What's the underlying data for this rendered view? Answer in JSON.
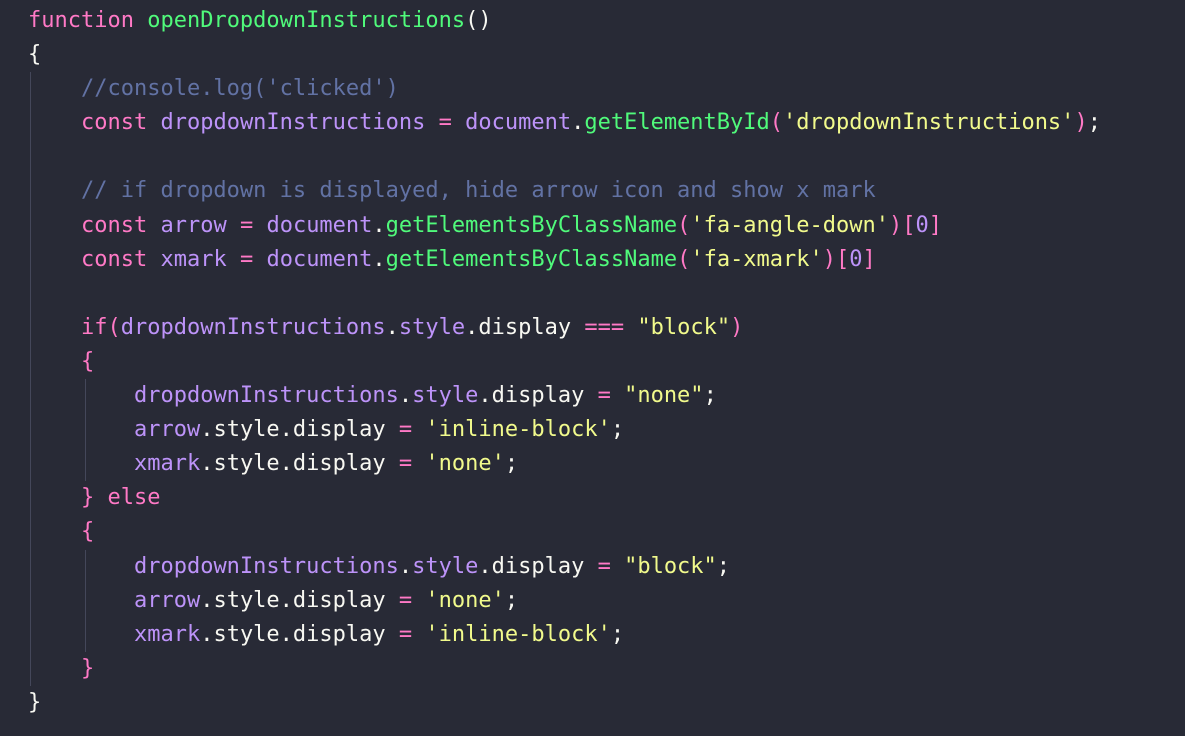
{
  "theme": {
    "background": "#282a36",
    "guide": "#44475a",
    "colors": {
      "kw": "#ff79c6",
      "fn": "#50fa7b",
      "str": "#f1fa8c",
      "var": "#bd93f9",
      "cmt": "#6272a4",
      "plain": "#f8f8f2",
      "brk": "#ff79c6",
      "brk2": "#ff79c6"
    }
  },
  "code": {
    "lines": [
      {
        "indent": 0,
        "guides": 0,
        "tokens": [
          {
            "t": "function",
            "c": "kw"
          },
          {
            "t": " ",
            "c": "plain"
          },
          {
            "t": "openDropdownInstructions",
            "c": "fn"
          },
          {
            "t": "()",
            "c": "plain"
          }
        ]
      },
      {
        "indent": 0,
        "guides": 0,
        "tokens": [
          {
            "t": "{",
            "c": "plain"
          }
        ]
      },
      {
        "indent": 1,
        "guides": 1,
        "tokens": [
          {
            "t": "//console.log('clicked')",
            "c": "cmt"
          }
        ]
      },
      {
        "indent": 1,
        "guides": 1,
        "tokens": [
          {
            "t": "const",
            "c": "kw"
          },
          {
            "t": " ",
            "c": "plain"
          },
          {
            "t": "dropdownInstructions",
            "c": "var"
          },
          {
            "t": " = ",
            "c": "kw"
          },
          {
            "t": "document",
            "c": "var"
          },
          {
            "t": ".",
            "c": "plain"
          },
          {
            "t": "getElementById",
            "c": "fn"
          },
          {
            "t": "(",
            "c": "brk"
          },
          {
            "t": "'dropdownInstructions'",
            "c": "str"
          },
          {
            "t": ")",
            "c": "brk"
          },
          {
            "t": ";",
            "c": "plain"
          }
        ]
      },
      {
        "indent": 1,
        "guides": 1,
        "tokens": []
      },
      {
        "indent": 1,
        "guides": 1,
        "tokens": [
          {
            "t": "// if dropdown is displayed, hide arrow icon and show x mark",
            "c": "cmt"
          }
        ]
      },
      {
        "indent": 1,
        "guides": 1,
        "tokens": [
          {
            "t": "const",
            "c": "kw"
          },
          {
            "t": " ",
            "c": "plain"
          },
          {
            "t": "arrow",
            "c": "var"
          },
          {
            "t": " = ",
            "c": "kw"
          },
          {
            "t": "document",
            "c": "var"
          },
          {
            "t": ".",
            "c": "plain"
          },
          {
            "t": "getElementsByClassName",
            "c": "fn"
          },
          {
            "t": "(",
            "c": "brk"
          },
          {
            "t": "'fa-angle-down'",
            "c": "str"
          },
          {
            "t": ")",
            "c": "brk"
          },
          {
            "t": "[",
            "c": "brk"
          },
          {
            "t": "0",
            "c": "var"
          },
          {
            "t": "]",
            "c": "brk"
          }
        ]
      },
      {
        "indent": 1,
        "guides": 1,
        "tokens": [
          {
            "t": "const",
            "c": "kw"
          },
          {
            "t": " ",
            "c": "plain"
          },
          {
            "t": "xmark",
            "c": "var"
          },
          {
            "t": " = ",
            "c": "kw"
          },
          {
            "t": "document",
            "c": "var"
          },
          {
            "t": ".",
            "c": "plain"
          },
          {
            "t": "getElementsByClassName",
            "c": "fn"
          },
          {
            "t": "(",
            "c": "brk"
          },
          {
            "t": "'fa-xmark'",
            "c": "str"
          },
          {
            "t": ")",
            "c": "brk"
          },
          {
            "t": "[",
            "c": "brk"
          },
          {
            "t": "0",
            "c": "var"
          },
          {
            "t": "]",
            "c": "brk"
          }
        ]
      },
      {
        "indent": 1,
        "guides": 1,
        "tokens": []
      },
      {
        "indent": 1,
        "guides": 1,
        "tokens": [
          {
            "t": "if",
            "c": "kw"
          },
          {
            "t": "(",
            "c": "brk"
          },
          {
            "t": "dropdownInstructions",
            "c": "var"
          },
          {
            "t": ".",
            "c": "plain"
          },
          {
            "t": "style",
            "c": "var"
          },
          {
            "t": ".display ",
            "c": "plain"
          },
          {
            "t": "===",
            "c": "kw"
          },
          {
            "t": " ",
            "c": "plain"
          },
          {
            "t": "\"block\"",
            "c": "str"
          },
          {
            "t": ")",
            "c": "brk"
          }
        ]
      },
      {
        "indent": 1,
        "guides": 1,
        "tokens": [
          {
            "t": "{",
            "c": "brk"
          }
        ]
      },
      {
        "indent": 2,
        "guides": 2,
        "tokens": [
          {
            "t": "dropdownInstructions",
            "c": "var"
          },
          {
            "t": ".",
            "c": "plain"
          },
          {
            "t": "style",
            "c": "var"
          },
          {
            "t": ".display ",
            "c": "plain"
          },
          {
            "t": "=",
            "c": "kw"
          },
          {
            "t": " ",
            "c": "plain"
          },
          {
            "t": "\"none\"",
            "c": "str"
          },
          {
            "t": ";",
            "c": "plain"
          }
        ]
      },
      {
        "indent": 2,
        "guides": 2,
        "tokens": [
          {
            "t": "arrow",
            "c": "var"
          },
          {
            "t": ".style.display ",
            "c": "plain"
          },
          {
            "t": "=",
            "c": "kw"
          },
          {
            "t": " ",
            "c": "plain"
          },
          {
            "t": "'inline-block'",
            "c": "str"
          },
          {
            "t": ";",
            "c": "plain"
          }
        ]
      },
      {
        "indent": 2,
        "guides": 2,
        "tokens": [
          {
            "t": "xmark",
            "c": "var"
          },
          {
            "t": ".style.display ",
            "c": "plain"
          },
          {
            "t": "=",
            "c": "kw"
          },
          {
            "t": " ",
            "c": "plain"
          },
          {
            "t": "'none'",
            "c": "str"
          },
          {
            "t": ";",
            "c": "plain"
          }
        ]
      },
      {
        "indent": 1,
        "guides": 1,
        "tokens": [
          {
            "t": "}",
            "c": "brk"
          },
          {
            "t": " ",
            "c": "plain"
          },
          {
            "t": "else",
            "c": "kw"
          }
        ]
      },
      {
        "indent": 1,
        "guides": 1,
        "tokens": [
          {
            "t": "{",
            "c": "brk"
          }
        ]
      },
      {
        "indent": 2,
        "guides": 2,
        "tokens": [
          {
            "t": "dropdownInstructions",
            "c": "var"
          },
          {
            "t": ".",
            "c": "plain"
          },
          {
            "t": "style",
            "c": "var"
          },
          {
            "t": ".display ",
            "c": "plain"
          },
          {
            "t": "=",
            "c": "kw"
          },
          {
            "t": " ",
            "c": "plain"
          },
          {
            "t": "\"block\"",
            "c": "str"
          },
          {
            "t": ";",
            "c": "plain"
          }
        ]
      },
      {
        "indent": 2,
        "guides": 2,
        "tokens": [
          {
            "t": "arrow",
            "c": "var"
          },
          {
            "t": ".style.display ",
            "c": "plain"
          },
          {
            "t": "=",
            "c": "kw"
          },
          {
            "t": " ",
            "c": "plain"
          },
          {
            "t": "'none'",
            "c": "str"
          },
          {
            "t": ";",
            "c": "plain"
          }
        ]
      },
      {
        "indent": 2,
        "guides": 2,
        "tokens": [
          {
            "t": "xmark",
            "c": "var"
          },
          {
            "t": ".style.display ",
            "c": "plain"
          },
          {
            "t": "=",
            "c": "kw"
          },
          {
            "t": " ",
            "c": "plain"
          },
          {
            "t": "'inline-block'",
            "c": "str"
          },
          {
            "t": ";",
            "c": "plain"
          }
        ]
      },
      {
        "indent": 1,
        "guides": 1,
        "tokens": [
          {
            "t": "}",
            "c": "brk"
          }
        ]
      },
      {
        "indent": 0,
        "guides": 0,
        "tokens": [
          {
            "t": "}",
            "c": "plain"
          }
        ]
      }
    ]
  }
}
